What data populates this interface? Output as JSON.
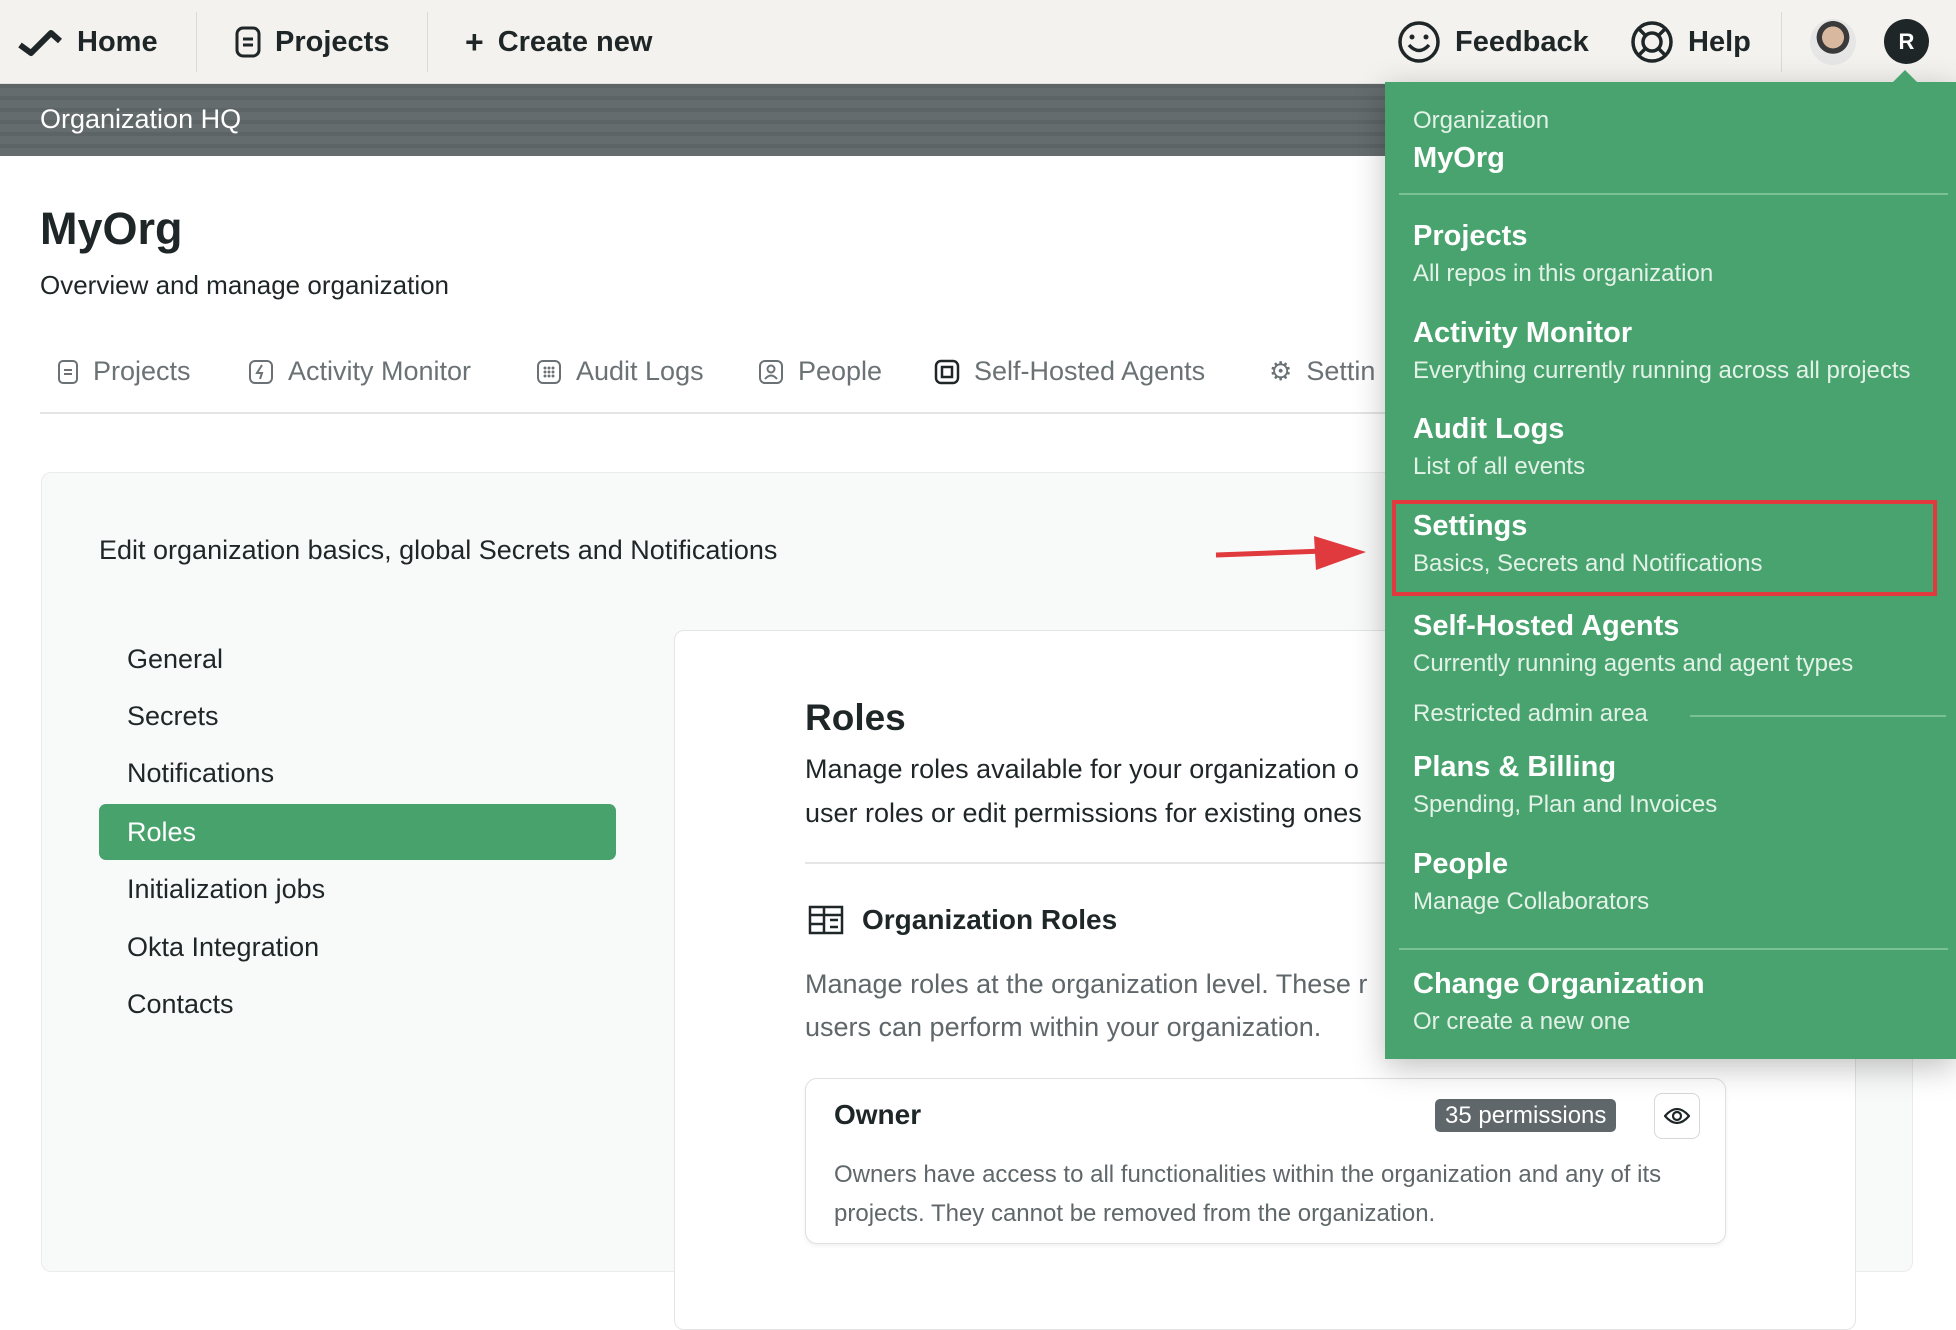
{
  "topnav": {
    "home": "Home",
    "projects": "Projects",
    "create_new": "Create new",
    "feedback": "Feedback",
    "help": "Help",
    "avatar_initial": "R"
  },
  "banner": {
    "title": "Organization HQ"
  },
  "header": {
    "title": "MyOrg",
    "subtitle": "Overview and manage organization"
  },
  "tabs": [
    {
      "label": "Projects",
      "icon": "document-icon"
    },
    {
      "label": "Activity Monitor",
      "icon": "bolt-icon"
    },
    {
      "label": "Audit Logs",
      "icon": "grid-icon"
    },
    {
      "label": "People",
      "icon": "person-icon"
    },
    {
      "label": "Self-Hosted Agents",
      "icon": "chip-icon"
    },
    {
      "label": "Settin",
      "icon": "gear-icon"
    }
  ],
  "settings": {
    "description": "Edit organization basics, global Secrets and Notifications",
    "sidebar": [
      "General",
      "Secrets",
      "Notifications",
      "Roles",
      "Initialization jobs",
      "Okta Integration",
      "Contacts"
    ],
    "active": "Roles"
  },
  "roles": {
    "title": "Roles",
    "description_1": "Manage roles available for your organization o",
    "description_2": "user roles or edit permissions for existing ones",
    "org_roles_title": "Organization Roles",
    "org_roles_desc_1": "Manage roles at the organization level. These r",
    "org_roles_desc_2": "users can perform within your organization.",
    "owner": {
      "name": "Owner",
      "permissions": "35 permissions",
      "desc_1": "Owners have access to all functionalities within the organization and any of its",
      "desc_2": "projects. They cannot be removed from the organization."
    }
  },
  "dropdown": {
    "org_label": "Organization",
    "org_name": "MyOrg",
    "items": [
      {
        "title": "Projects",
        "sub": "All repos in this organization"
      },
      {
        "title": "Activity Monitor",
        "sub": "Everything currently running across all projects"
      },
      {
        "title": "Audit Logs",
        "sub": "List of all events"
      },
      {
        "title": "Settings",
        "sub": "Basics, Secrets and Notifications"
      },
      {
        "title": "Self-Hosted Agents",
        "sub": "Currently running agents and agent types"
      }
    ],
    "restricted": "Restricted admin area",
    "admin_items": [
      {
        "title": "Plans & Billing",
        "sub": "Spending, Plan and Invoices"
      },
      {
        "title": "People",
        "sub": "Manage Collaborators"
      }
    ],
    "change_org": {
      "title": "Change Organization",
      "sub": "Or create a new one"
    }
  },
  "colors": {
    "brand_green": "#49a36e",
    "highlight_red": "#e0393e",
    "banner": "#656c6e",
    "nav_bg": "#f3f2ee"
  }
}
